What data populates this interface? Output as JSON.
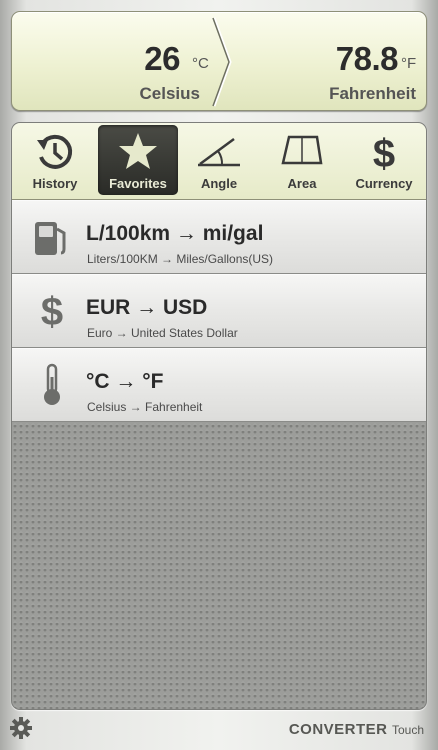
{
  "display": {
    "from_value": "26",
    "from_unit": "°C",
    "from_name": "Celsius",
    "to_value": "78.8",
    "to_unit": "°F",
    "to_name": "Fahrenheit"
  },
  "tabs": [
    {
      "label": "History",
      "icon": "history-icon",
      "active": false
    },
    {
      "label": "Favorites",
      "icon": "star-icon",
      "active": true
    },
    {
      "label": "Angle",
      "icon": "angle-icon",
      "active": false
    },
    {
      "label": "Area",
      "icon": "area-icon",
      "active": false
    },
    {
      "label": "Currency",
      "icon": "dollar-icon",
      "active": false
    }
  ],
  "favorites": [
    {
      "title": "L/100km → mi/gal",
      "subtitle": "Liters/100KM → Miles/Gallons(US)",
      "icon": "fuel-pump-icon"
    },
    {
      "title": "EUR → USD",
      "subtitle": "Euro → United States Dollar",
      "icon": "dollar-icon"
    },
    {
      "title": "°C → °F",
      "subtitle": "Celsius → Fahrenheit",
      "icon": "thermometer-icon"
    }
  ],
  "footer": {
    "brand_main": "CONVERTER",
    "brand_sub": "Touch",
    "settings_icon": "gear-icon"
  },
  "colors": {
    "display_bg": "#eef1d2",
    "active_tab": "#2f302c",
    "text_dark": "#2c2c2c"
  }
}
